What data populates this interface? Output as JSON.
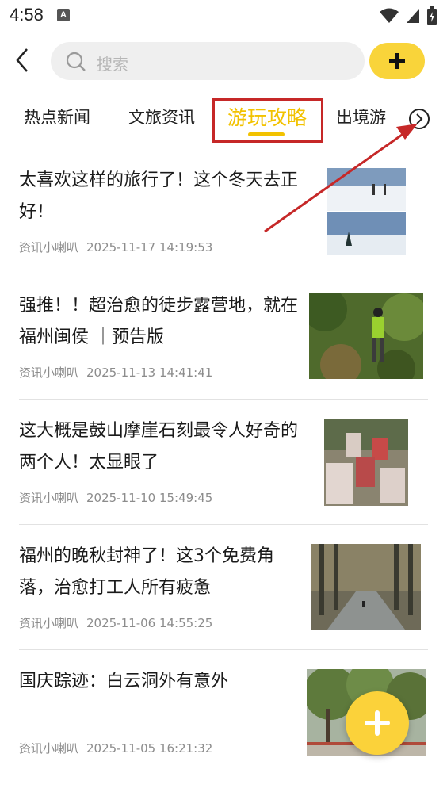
{
  "status_bar": {
    "time": "4:58",
    "notification_letter": "A"
  },
  "search": {
    "placeholder": "搜索"
  },
  "tabs": [
    {
      "label": "热点新闻"
    },
    {
      "label": "文旅资讯"
    },
    {
      "label": "游玩攻略",
      "active": true
    },
    {
      "label": "出境游"
    }
  ],
  "colors": {
    "accent": "#f2c200",
    "button_yellow": "#f9d43a",
    "annotation_red": "#c62828"
  },
  "articles": [
    {
      "title": "太喜欢这样的旅行了！这个冬天去正好！",
      "source": "资讯小喇叭",
      "time": "2025-11-17 14:19:53",
      "thumb": "snow-hiking-photo"
    },
    {
      "title": "强推！！超治愈的徒步露营地，就在福州闽侯 ｜预告版",
      "source": "资讯小喇叭",
      "time": "2025-11-13 14:41:41",
      "thumb": "forest-hiker-photo"
    },
    {
      "title": "这大概是鼓山摩崖石刻最令人好奇的两个人！太显眼了",
      "source": "资讯小喇叭",
      "time": "2025-11-10 15:49:45",
      "thumb": "cliff-carvings-photo"
    },
    {
      "title": "福州的晚秋封神了！这3个免费角落，治愈打工人所有疲惫",
      "source": "资讯小喇叭",
      "time": "2025-11-06 14:55:25",
      "thumb": "tree-lined-road-photo"
    },
    {
      "title": "国庆踪迹：白云洞外有意外",
      "source": "资讯小喇叭",
      "time": "2025-11-05 16:21:32",
      "thumb": "park-trees-photo"
    }
  ]
}
